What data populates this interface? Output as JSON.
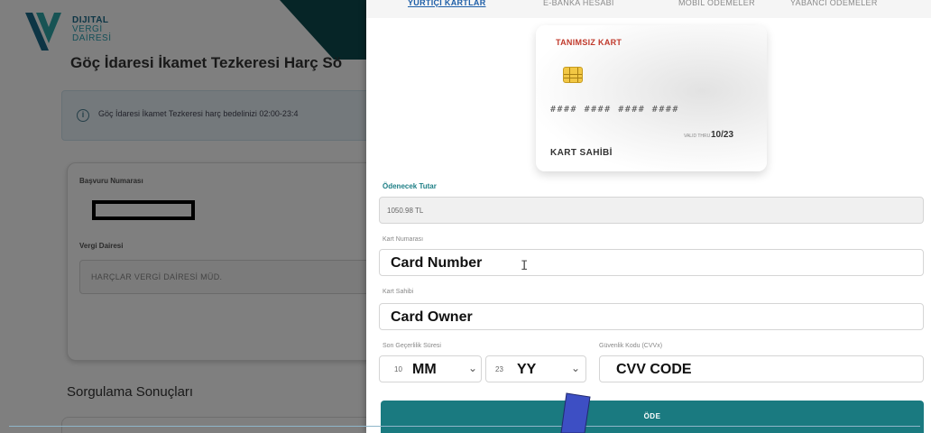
{
  "background": {
    "logo": {
      "line1": "DIJITAL",
      "line2": "VERGİ",
      "line3": "DAİRESİ"
    },
    "page_title": "Göç İdaresi İkamet Tezkeresi Harç Sö",
    "info_text": "Göç İdaresi İkamet Tezkeresi harç bedelinizi 02:00-23:4",
    "application_number_label": "Başvuru Numarası",
    "tax_office_label": "Vergi Dairesi",
    "tax_office_value": "HARÇLAR VERGİ DAİRESİ MÜD.",
    "results_heading": "Sorgulama Sonuçları"
  },
  "modal": {
    "tabs": [
      "YURTİÇİ KARTLAR",
      "E-BANKA HESABI",
      "MOBİL ÖDEMELER",
      "YABANCI ÖDEMELER"
    ],
    "card": {
      "title": "TANIMSIZ KART",
      "number": "#### #### #### ####",
      "valid_thru_label": "VALID THRU",
      "valid_thru_value": "10/23",
      "holder": "KART SAHİBİ"
    },
    "amount_label": "Ödenecek Tutar",
    "amount_value": "1050.98 TL",
    "card_number_label": "Kart Numarası",
    "card_number_value": "Card Number",
    "card_owner_label": "Kart Sahibi",
    "card_owner_value": "Card Owner",
    "expiry_label": "Son Geçerlilik Süresi",
    "expiry_month_prefix": "10",
    "expiry_month_value": "MM",
    "expiry_year_prefix": "23",
    "expiry_year_value": "YY",
    "cvv_label": "Güvenlik Kodu (CVVx)",
    "cvv_value": "CVV CODE",
    "pay_button": "ÖDE"
  },
  "colors": {
    "accent": "#1a7a80",
    "active_tab": "#1e5fa8",
    "card_title": "#c0392b",
    "header_dark": "#0c4a4f"
  },
  "icons": [
    "info-icon",
    "chip-icon",
    "chevron-down-icon",
    "text-cursor-icon"
  ]
}
